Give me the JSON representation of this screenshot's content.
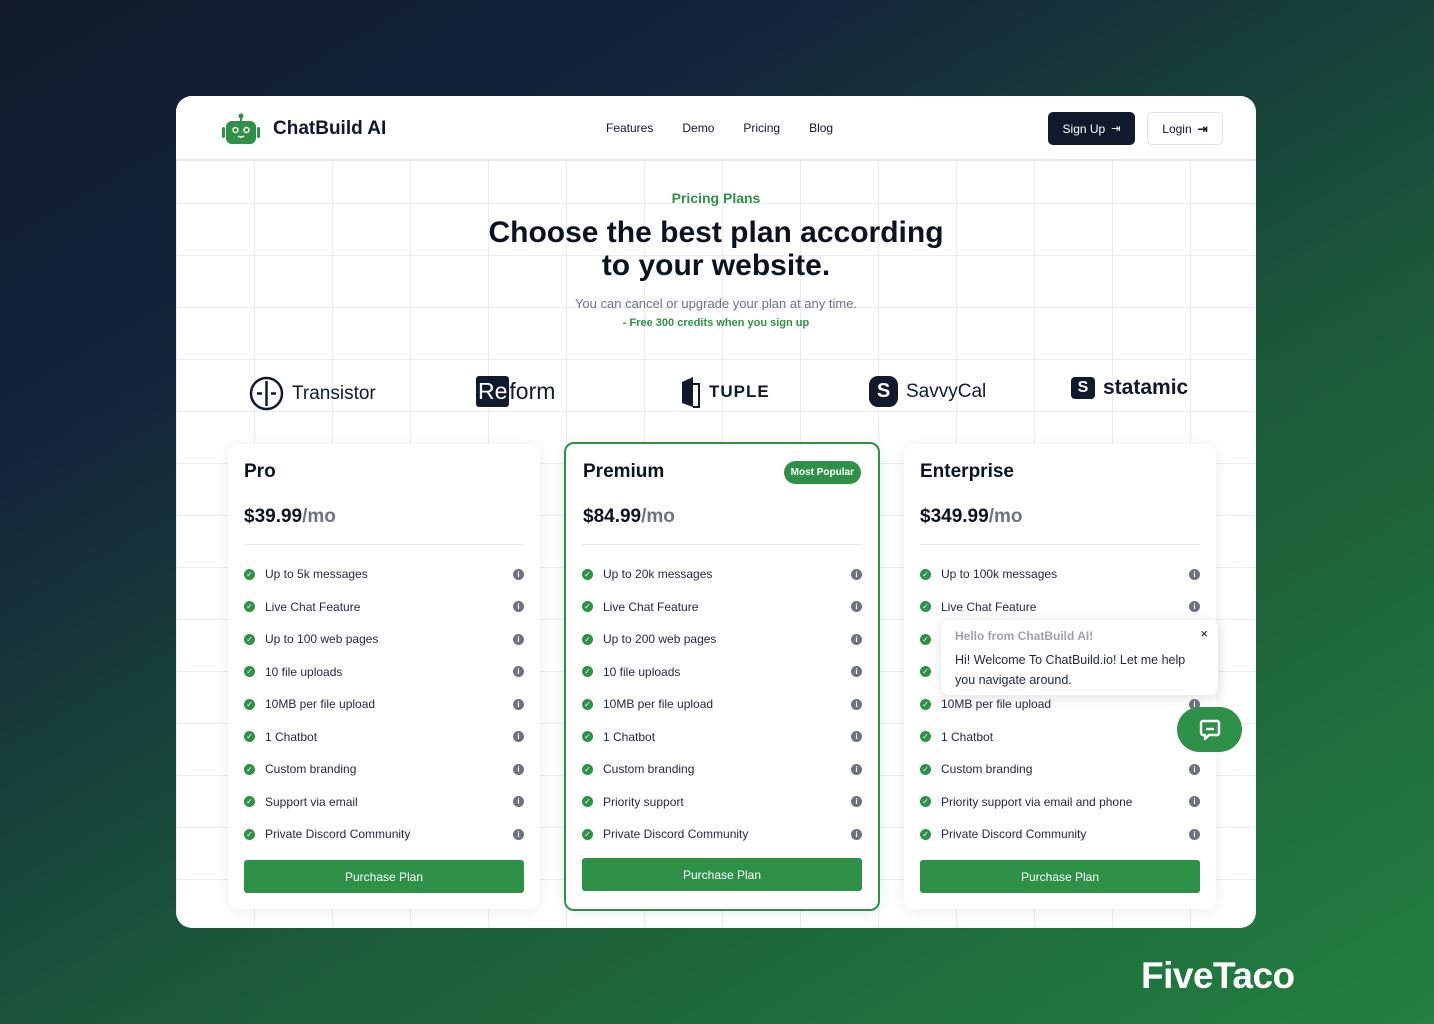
{
  "header": {
    "brand": "ChatBuild AI",
    "nav": [
      "Features",
      "Demo",
      "Pricing",
      "Blog"
    ],
    "signup": "Sign Up",
    "login": "Login"
  },
  "hero": {
    "eyebrow": "Pricing Plans",
    "title_line1": "Choose the best plan according",
    "title_line2": "to your website.",
    "subtitle": "You can cancel or upgrade your plan at any time.",
    "credits": "- Free 300 credits when you sign up"
  },
  "logos": {
    "transistor": "Transistor",
    "reform_a": "Re",
    "reform_b": "form",
    "tuple": "TUPLE",
    "savvycal": "SavvyCal",
    "statamic": "statamic",
    "savvycal_mark": "S",
    "statamic_mark": "S"
  },
  "plans": [
    {
      "name": "Pro",
      "price": "$39.99",
      "period": "/mo",
      "features": [
        "Up to 5k messages",
        "Live Chat Feature",
        "Up to 100 web pages",
        "10 file uploads",
        "10MB per file upload",
        "1 Chatbot",
        "Custom branding",
        "Support via email",
        "Private Discord Community"
      ],
      "cta": "Purchase Plan"
    },
    {
      "name": "Premium",
      "badge": "Most Popular",
      "price": "$84.99",
      "period": "/mo",
      "features": [
        "Up to 20k messages",
        "Live Chat Feature",
        "Up to 200 web pages",
        "10 file uploads",
        "10MB per file upload",
        "1 Chatbot",
        "Custom branding",
        "Priority support",
        "Private Discord Community"
      ],
      "cta": "Purchase Plan"
    },
    {
      "name": "Enterprise",
      "price": "$349.99",
      "period": "/mo",
      "features": [
        "Up to 100k messages",
        "Live Chat Feature",
        "",
        "",
        "10MB per file upload",
        "1 Chatbot",
        "Custom branding",
        "Priority support via email and phone",
        "Private Discord Community"
      ],
      "cta": "Purchase Plan"
    }
  ],
  "chat": {
    "title": "Hello from ChatBuild AI!",
    "message": "Hi! Welcome To ChatBuild.io! Let me help you navigate around.",
    "close": "×"
  },
  "watermark": "FiveTaco",
  "colors": {
    "accent": "#2e9147",
    "dark": "#111a2c"
  }
}
